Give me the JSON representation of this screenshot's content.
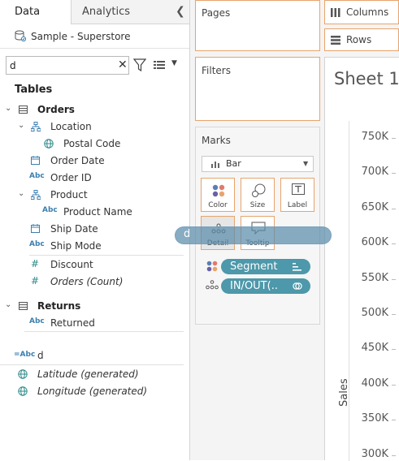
{
  "tabs": {
    "data": "Data",
    "analytics": "Analytics"
  },
  "datasource": {
    "name": "Sample - Superstore"
  },
  "search": {
    "value": "d"
  },
  "tables_header": "Tables",
  "tree": [
    {
      "label": "Orders",
      "kind": "table"
    },
    {
      "label": "Location",
      "kind": "hierarchy"
    },
    {
      "label": "Postal Code",
      "kind": "geo"
    },
    {
      "label": "Order Date",
      "kind": "date"
    },
    {
      "label": "Order ID",
      "kind": "string"
    },
    {
      "label": "Product",
      "kind": "hierarchy"
    },
    {
      "label": "Product Name",
      "kind": "string"
    },
    {
      "label": "Ship Date",
      "kind": "date"
    },
    {
      "label": "Ship Mode",
      "kind": "string"
    },
    {
      "label": "Discount",
      "kind": "measure"
    },
    {
      "label": "Orders (Count)",
      "kind": "measure"
    },
    {
      "label": "Returns",
      "kind": "table"
    },
    {
      "label": "Returned",
      "kind": "string"
    },
    {
      "label": "d",
      "kind": "calc-string"
    },
    {
      "label": "Latitude (generated)",
      "kind": "geo"
    },
    {
      "label": "Longitude (generated)",
      "kind": "geo"
    }
  ],
  "shelves": {
    "pages": "Pages",
    "filters": "Filters",
    "columns": "Columns",
    "rows": "Rows"
  },
  "marks": {
    "title": "Marks",
    "type": "Bar",
    "buttons": {
      "color": "Color",
      "size": "Size",
      "label": "Label",
      "detail": "Detail",
      "tooltip": "Tooltip"
    },
    "pills": [
      {
        "label": "Segment"
      },
      {
        "label": "IN/OUT(.."
      }
    ]
  },
  "drag_ghost": "d",
  "sheet": {
    "title": "Sheet 1",
    "y_axis_label": "Sales"
  },
  "y_ticks": [
    "750K",
    "700K",
    "650K",
    "600K",
    "550K",
    "500K",
    "450K",
    "400K",
    "350K",
    "300K"
  ],
  "colors": {
    "accent_border": "#e8a46c",
    "pill": "#4d98aa",
    "text": "#333333"
  }
}
